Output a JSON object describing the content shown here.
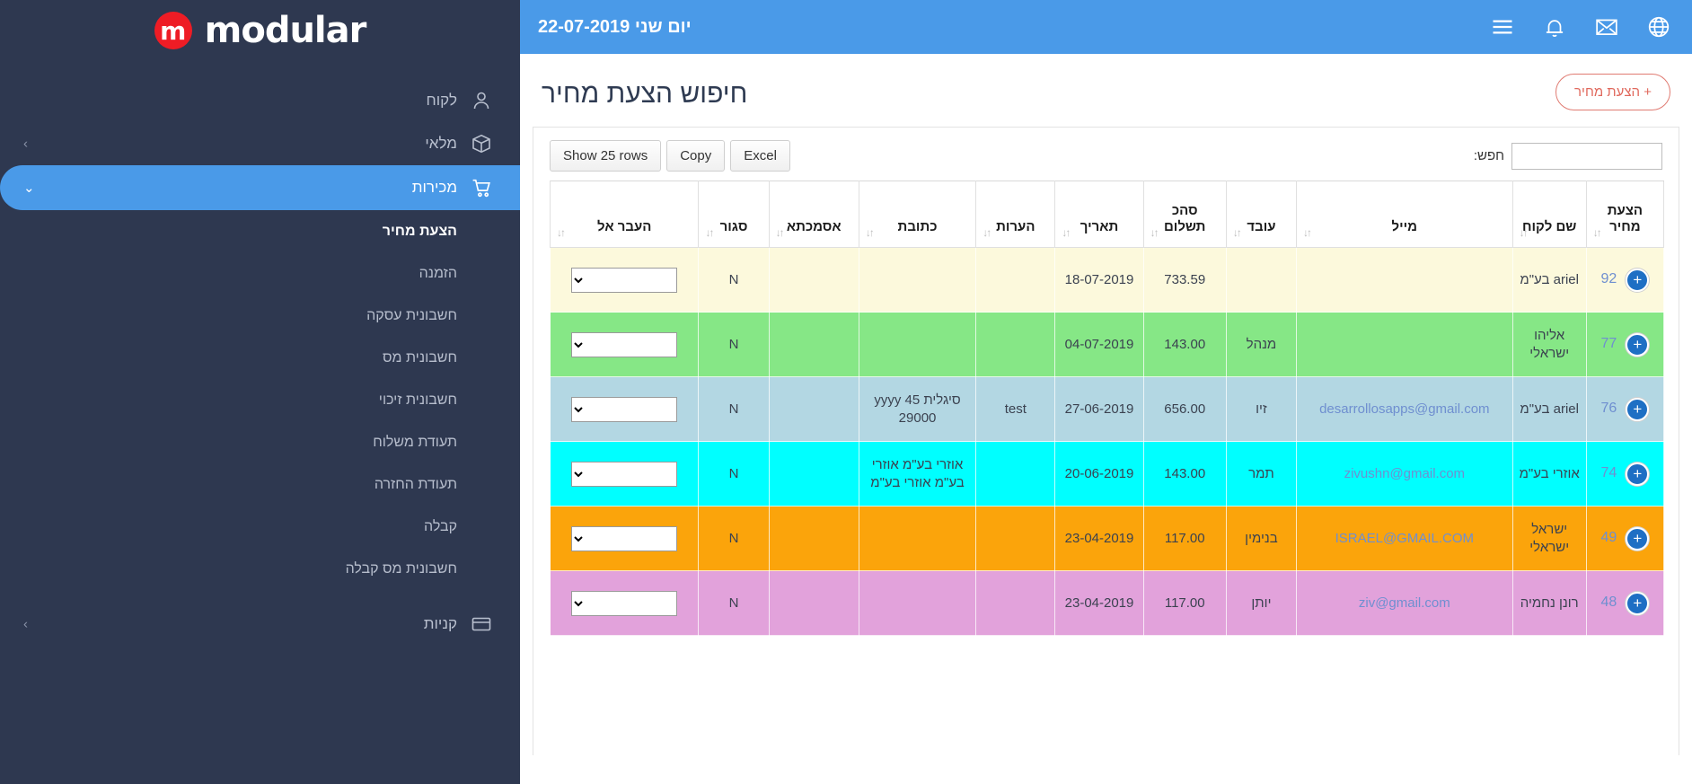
{
  "brand": {
    "name": "modular",
    "badge": "m",
    "badge_color": "#ee1c25"
  },
  "topbar": {
    "date": "יום שני 22-07-2019",
    "bg_color": "#4a9ae8",
    "icons": [
      {
        "name": "globe-icon",
        "label": "globe"
      },
      {
        "name": "mail-icon",
        "label": "mail"
      },
      {
        "name": "bell-icon",
        "label": "notifications"
      },
      {
        "name": "hamburger-icon",
        "label": "menu"
      }
    ]
  },
  "page": {
    "title": "חיפוש הצעת מחיר",
    "add_button": "+ הצעת מחיר"
  },
  "toolbar": {
    "excel": "Excel",
    "copy": "Copy",
    "show_rows": "Show 25 rows",
    "search_label": "חפש:",
    "search_value": "",
    "search_placeholder": ""
  },
  "sidebar": {
    "top_items": [
      {
        "label": "לקוח",
        "icon": "user-icon",
        "has_chevron": false,
        "active": false
      },
      {
        "label": "מלאי",
        "icon": "box-icon",
        "has_chevron": true,
        "active": false
      },
      {
        "label": "מכירות",
        "icon": "cart-icon",
        "has_chevron": true,
        "active": true
      }
    ],
    "sub_items": [
      {
        "label": "הצעת מחיר",
        "current": true
      },
      {
        "label": "הזמנה",
        "current": false
      },
      {
        "label": "חשבונית עסקה",
        "current": false
      },
      {
        "label": "חשבונית מס",
        "current": false
      },
      {
        "label": "חשבונית זיכוי",
        "current": false
      },
      {
        "label": "תעודת משלוח",
        "current": false
      },
      {
        "label": "תעודת החזרה",
        "current": false
      },
      {
        "label": "קבלה",
        "current": false
      },
      {
        "label": "חשבונית מס קבלה",
        "current": false
      }
    ],
    "bottom_items": [
      {
        "label": "קניות",
        "icon": "card-icon",
        "has_chevron": true,
        "active": false
      }
    ],
    "bg_color": "#2e3850",
    "active_color": "#4a9ae8"
  },
  "table": {
    "columns": [
      {
        "key": "quote",
        "label": "הצעת מחיר",
        "sortable": true
      },
      {
        "key": "customer",
        "label": "שם לקוח",
        "sortable": true
      },
      {
        "key": "mail",
        "label": "מייל",
        "sortable": true
      },
      {
        "key": "worker",
        "label": "עובד",
        "sortable": true
      },
      {
        "key": "total",
        "label": "סהכ תשלום",
        "sortable": true
      },
      {
        "key": "date",
        "label": "תאריך",
        "sortable": true
      },
      {
        "key": "notes",
        "label": "הערות",
        "sortable": true
      },
      {
        "key": "address",
        "label": "כתובת",
        "sortable": true
      },
      {
        "key": "ref",
        "label": "אסמכתא",
        "sortable": true
      },
      {
        "key": "closed",
        "label": "סגור",
        "sortable": true
      },
      {
        "key": "moveto",
        "label": "העבר אל",
        "sortable": true
      }
    ],
    "rows": [
      {
        "quote": "92",
        "customer": "ariel בע\"מ",
        "mail": "",
        "worker": "",
        "total": "733.59",
        "date": "18-07-2019",
        "notes": "",
        "address": "",
        "ref": "",
        "closed": "N",
        "moveto": "",
        "bg": "#fcf9dc"
      },
      {
        "quote": "77",
        "customer": "אליהו ישראלי",
        "mail": "",
        "worker": "מנהל",
        "total": "143.00",
        "date": "04-07-2019",
        "notes": "",
        "address": "",
        "ref": "",
        "closed": "N",
        "moveto": "",
        "bg": "#86e786"
      },
      {
        "quote": "76",
        "customer": "ariel בע\"מ",
        "mail": "desarrollosapps@gmail.com",
        "worker": "זיו",
        "total": "656.00",
        "date": "27-06-2019",
        "notes": "test",
        "address": "סיגלית 45 yyyy 29000",
        "ref": "",
        "closed": "N",
        "moveto": "",
        "bg": "#b3d7e3"
      },
      {
        "quote": "74",
        "customer": "אוזרי בע\"מ",
        "mail": "zivushn@gmail.com",
        "worker": "תמר",
        "total": "143.00",
        "date": "20-06-2019",
        "notes": "",
        "address": "אוזרי בע\"מ אוזרי בע\"מ אוזרי בע\"מ",
        "ref": "",
        "closed": "N",
        "moveto": "",
        "bg": "#00ffff"
      },
      {
        "quote": "49",
        "customer": "ישראל ישראלי",
        "mail": "ISRAEL@GMAIL.COM",
        "worker": "בנימין",
        "total": "117.00",
        "date": "23-04-2019",
        "notes": "",
        "address": "",
        "ref": "",
        "closed": "N",
        "moveto": "",
        "bg": "#fba40b"
      },
      {
        "quote": "48",
        "customer": "רונן נחמיה",
        "mail": "ziv@gmail.com",
        "worker": "יותן",
        "total": "117.00",
        "date": "23-04-2019",
        "notes": "",
        "address": "",
        "ref": "",
        "closed": "N",
        "moveto": "",
        "bg": "#e2a2db"
      }
    ]
  }
}
